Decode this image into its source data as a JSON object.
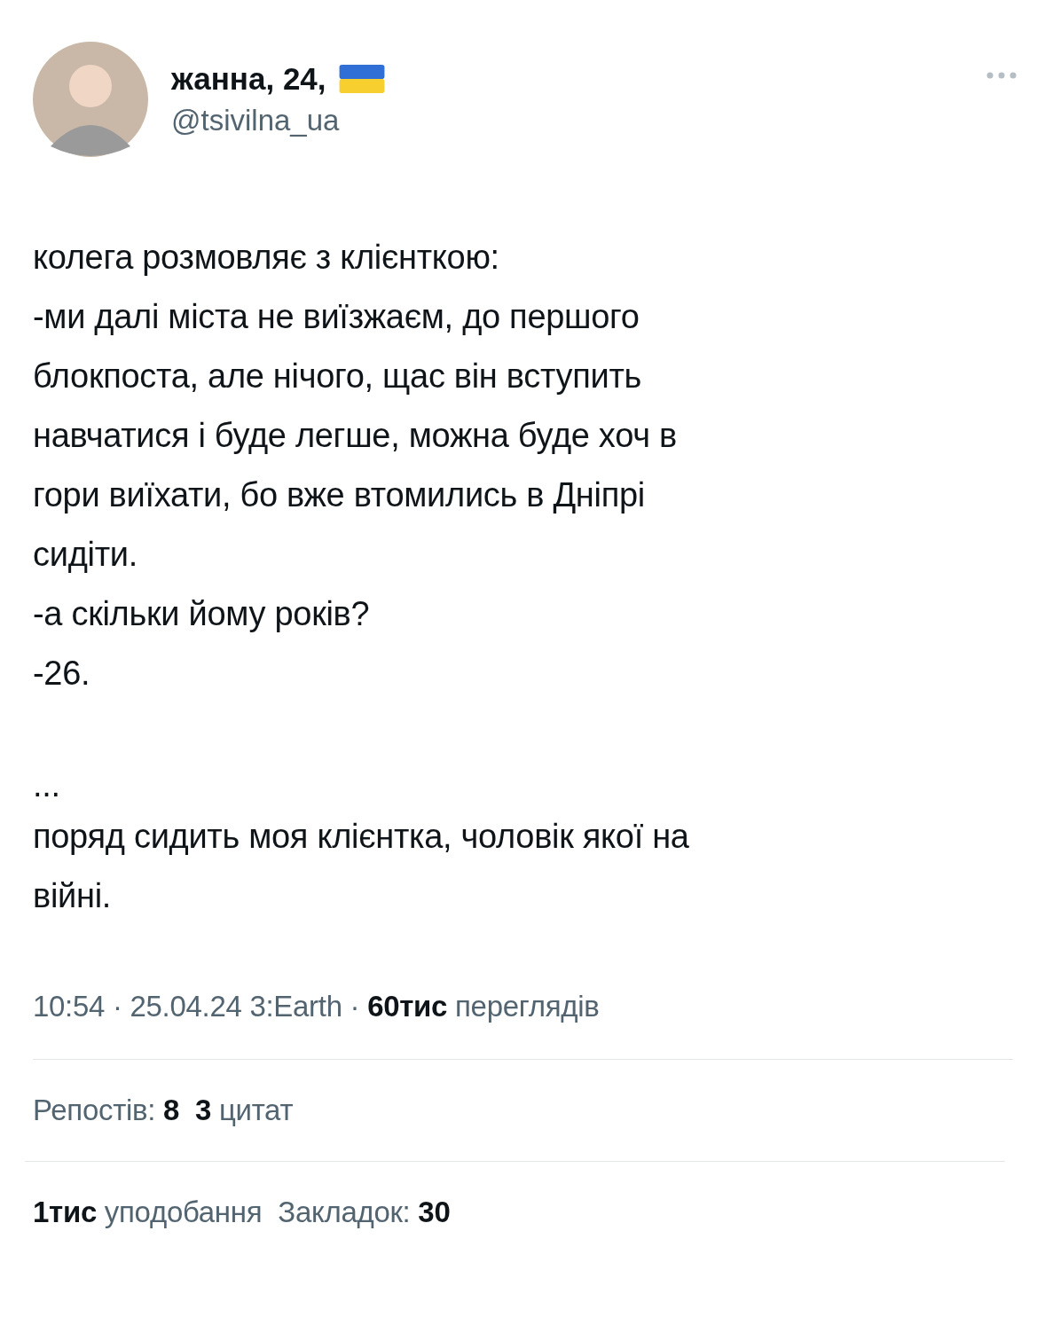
{
  "author": {
    "name": "жанна, 24,",
    "handle": "@tsivilna_ua"
  },
  "paragraphs": [
    "колега розмовляє з клієнткою:",
    "-ми далі міста не виїзжаєм, до першого\nблокпоста, але нічого, щас він вступить\nнавчатися і буде легше, можна буде хоч в\nгори виїхати, бо вже втомились в Дніпрі\nсидіти.",
    "-а скільки йому років?",
    "-26.",
    "...",
    "поряд сидить моя клієнтка, чоловік якої на\nвійні."
  ],
  "meta": "10:54 · 25.04.24 3:Earth · **60тис** переглядів",
  "stats_rows": [
    [
      "Репостів: **8**",
      "**3** цитат"
    ],
    [
      "**1тис** уподобання",
      "Закладок: **30**"
    ]
  ]
}
